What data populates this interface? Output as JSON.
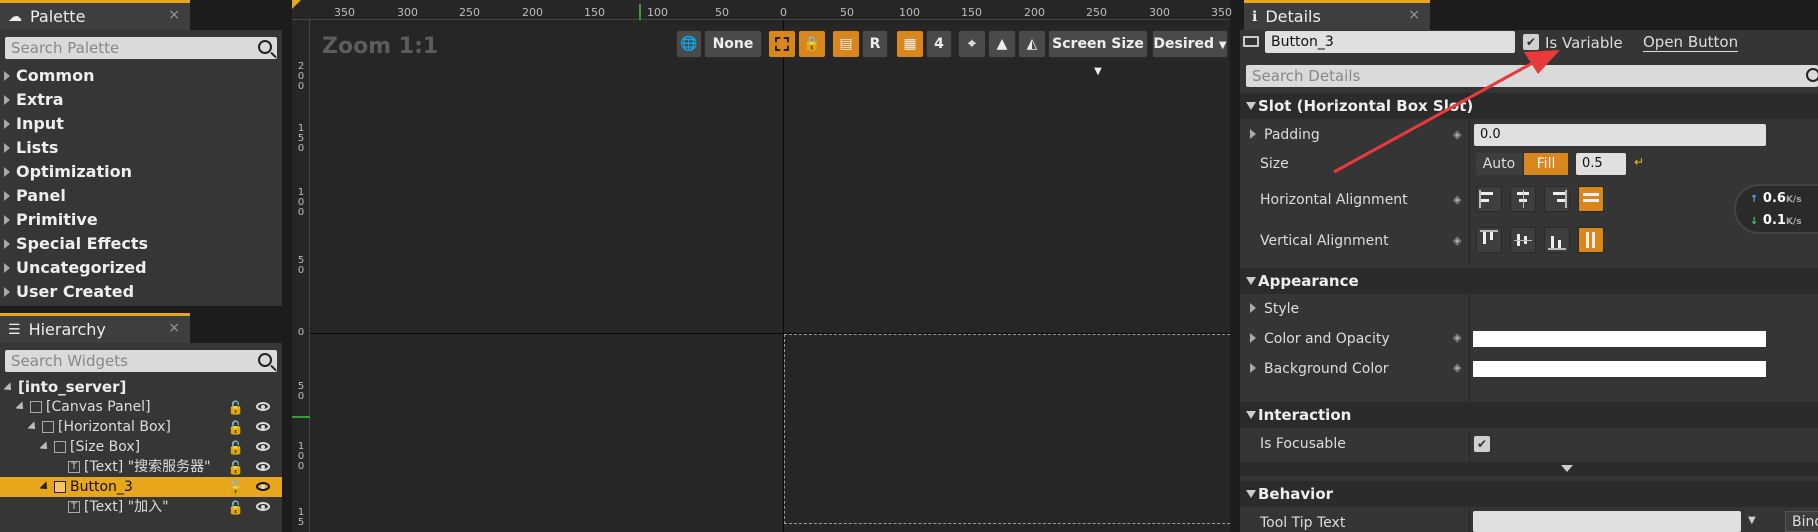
{
  "palette": {
    "tab_title": "Palette",
    "search_placeholder": "Search Palette",
    "categories": [
      "Common",
      "Extra",
      "Input",
      "Lists",
      "Optimization",
      "Panel",
      "Primitive",
      "Special Effects",
      "Uncategorized",
      "User Created"
    ]
  },
  "hierarchy": {
    "tab_title": "Hierarchy",
    "search_placeholder": "Search Widgets",
    "root": "[into_server]",
    "items": [
      {
        "label": "[Canvas Panel]"
      },
      {
        "label": "[Horizontal Box]"
      },
      {
        "label": "[Size Box]"
      },
      {
        "label": "[Text] \"搜索服务器\""
      },
      {
        "label": "Button_3"
      },
      {
        "label": "[Text] \"加入\""
      }
    ]
  },
  "viewport": {
    "zoom_label": "Zoom 1:1",
    "ruler_top": [
      "350",
      "300",
      "250",
      "200",
      "150",
      "100",
      "50",
      "0",
      "50",
      "100",
      "150",
      "200",
      "250",
      "300",
      "350"
    ],
    "ruler_left": [
      "2 0 0",
      "1 5 0",
      "1 0 0",
      "5 0",
      "0",
      "5 0",
      "1 0 0",
      "1 5"
    ],
    "toolbar": {
      "none_label": "None",
      "r_label": "R",
      "grid_value": "4",
      "screen_size_label": "Screen Size",
      "desired_label": "Desired"
    }
  },
  "details": {
    "tab_title": "Details",
    "name_value": "Button_3",
    "is_variable_label": "Is Variable",
    "open_button_label": "Open Button",
    "search_placeholder": "Search Details",
    "sections": {
      "slot": "Slot (Horizontal Box Slot)",
      "appearance": "Appearance",
      "interaction": "Interaction",
      "behavior": "Behavior"
    },
    "props": {
      "padding": "Padding",
      "padding_value": "0.0",
      "size": "Size",
      "size_auto": "Auto",
      "size_fill": "Fill",
      "size_value": "0.5",
      "halign": "Horizontal Alignment",
      "valign": "Vertical Alignment",
      "style": "Style",
      "color_opacity": "Color and Opacity",
      "background_color": "Background Color",
      "is_focusable": "Is Focusable",
      "tooltip_text": "Tool Tip Text",
      "bind_label": "Bind"
    }
  },
  "network_widget": {
    "up_value": "0.6",
    "up_unit": "K/s",
    "down_value": "0.1",
    "down_unit": "K/s"
  },
  "colors": {
    "accent": "#e8a61d",
    "orange_button": "#d9861c",
    "annotation_arrow": "#e83a3a"
  }
}
